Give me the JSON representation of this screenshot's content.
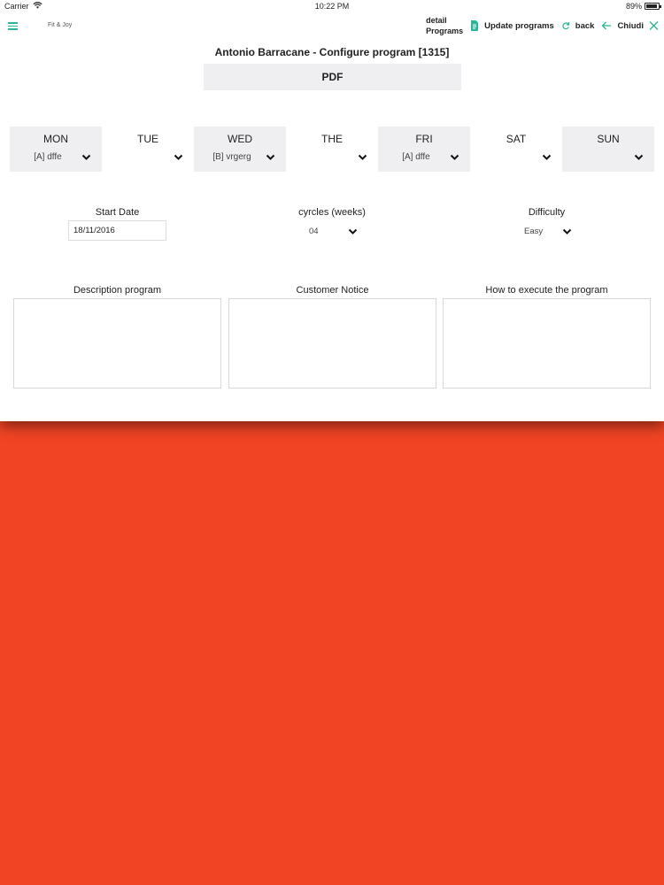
{
  "status_bar": {
    "carrier": "Carrier",
    "time": "10:22 PM",
    "battery": "89%",
    "battery_level": 0.89
  },
  "navbar": {
    "app_name": "Fit & Joy",
    "detail_line1": "detail",
    "detail_line2": "Programs",
    "update_label": "Update programs",
    "back_label": "back",
    "close_label": "Chiudi",
    "accent_color": "#2bb59a"
  },
  "title": "Antonio Barracane - Configure program [1315]",
  "pdf_label": "PDF",
  "days": [
    {
      "name": "MON",
      "value": "[A] dffe"
    },
    {
      "name": "TUE",
      "value": ""
    },
    {
      "name": "WED",
      "value": "[B] vrgerg"
    },
    {
      "name": "THE",
      "value": ""
    },
    {
      "name": "FRI",
      "value": "[A] dffe"
    },
    {
      "name": "SAT",
      "value": ""
    },
    {
      "name": "SUN",
      "value": ""
    }
  ],
  "fields": {
    "start_date_label": "Start Date",
    "start_date_value": "18/11/2016",
    "cycles_label": "cyrcles (weeks)",
    "cycles_value": "04",
    "difficulty_label": "Difficulty",
    "difficulty_value": "Easy"
  },
  "text_areas": {
    "description_label": "Description program",
    "notice_label": "Customer Notice",
    "execute_label": "How to execute the program"
  },
  "background_color": "#f04424"
}
